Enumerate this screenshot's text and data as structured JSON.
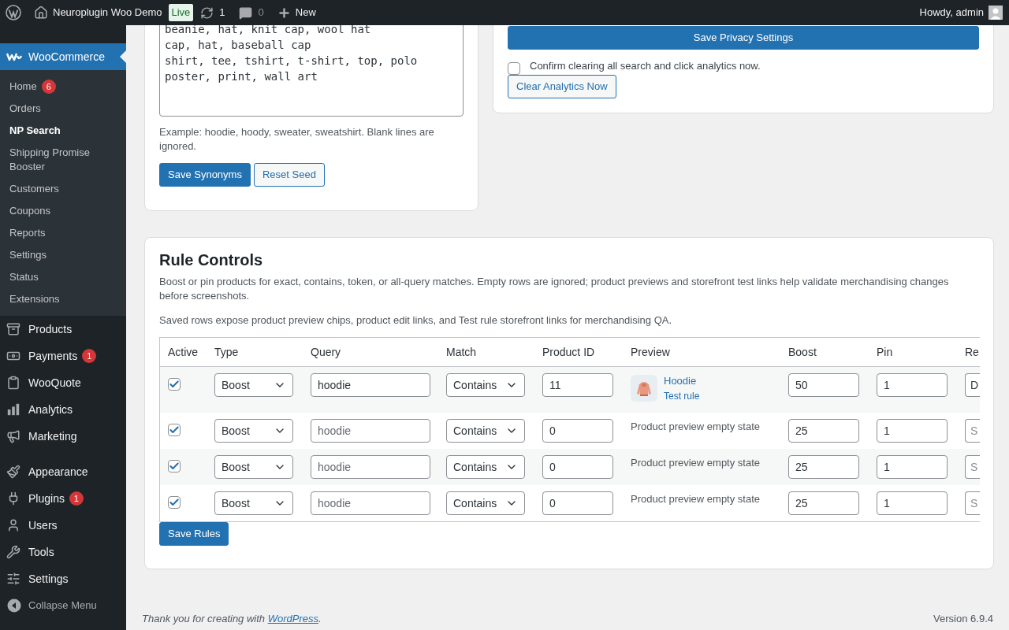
{
  "admin_bar": {
    "site": "Neuroplugin Woo Demo",
    "status": "Live",
    "updates": "1",
    "comments": "0",
    "new": "New",
    "greeting": "Howdy, admin"
  },
  "sidebar": {
    "current": {
      "label": "WooCommerce",
      "selected": true
    },
    "submenu": [
      {
        "label": "Home",
        "badge": "6",
        "selected": false
      },
      {
        "label": "Orders",
        "selected": false
      },
      {
        "label": "NP Search",
        "selected": true
      },
      {
        "label": "Shipping Promise Booster",
        "selected": false
      },
      {
        "label": "Customers",
        "selected": false
      },
      {
        "label": "Coupons",
        "selected": false
      },
      {
        "label": "Reports",
        "selected": false
      },
      {
        "label": "Settings",
        "selected": false
      },
      {
        "label": "Status",
        "selected": false
      },
      {
        "label": "Extensions",
        "selected": false
      }
    ],
    "menu_groups": [
      [
        {
          "label": "Products"
        },
        {
          "label": "Payments",
          "badge": "1"
        },
        {
          "label": "WooQuote"
        },
        {
          "label": "Analytics"
        },
        {
          "label": "Marketing"
        }
      ],
      [
        {
          "label": "Appearance"
        },
        {
          "label": "Plugins",
          "badge": "1"
        },
        {
          "label": "Users"
        },
        {
          "label": "Tools"
        },
        {
          "label": "Settings"
        }
      ]
    ],
    "collapse": "Collapse Menu"
  },
  "synonyms_card": {
    "lines": "beanie, hat, knit cap, wool hat\ncap, hat, baseball cap\nshirt, tee, tshirt, t-shirt, top, polo\nposter, print, wall art",
    "help": "Example: hoodie, hoody, sweater, sweatshirt. Blank lines are ignored.",
    "buttons": [
      {
        "label": "Save Synonyms",
        "kind": "primary"
      },
      {
        "label": "Reset Seed",
        "kind": "secondary"
      }
    ]
  },
  "privacy_card": {
    "save": "Save Privacy Settings",
    "confirm": {
      "label": "Confirm clearing all search and click analytics now.",
      "checked": false
    },
    "clear": "Clear Analytics Now"
  },
  "rules_card": {
    "title": "Rule Controls",
    "description": "Boost or pin products for exact, contains, token, or all-query matches. Empty rows are ignored; product previews and storefront test links help validate merchandising changes before screenshots.",
    "note": "Saved rows expose product preview chips, product edit links, and Test rule storefront links for merchandising QA.",
    "columns": [
      "Active",
      "Type",
      "Query",
      "Match",
      "Product ID",
      "Preview",
      "Boost",
      "Pin",
      "Re"
    ],
    "rows": [
      {
        "active": true,
        "type": "Boost",
        "query": {
          "value": "hoodie"
        },
        "match": "Contains",
        "product_id": "11",
        "preview": {
          "kind": "product",
          "name": "Hoodie",
          "link": "Test rule"
        },
        "boost": "50",
        "pin": "1",
        "column_9": {
          "value": "D"
        }
      },
      {
        "active": true,
        "type": "Boost",
        "query": {
          "placeholder": "hoodie"
        },
        "match": "Contains",
        "product_id": "0",
        "preview": {
          "kind": "empty",
          "text": "Product preview empty state"
        },
        "boost": "25",
        "pin": "1",
        "column_9": {
          "placeholder": "S"
        }
      },
      {
        "active": true,
        "type": "Boost",
        "query": {
          "placeholder": "hoodie"
        },
        "match": "Contains",
        "product_id": "0",
        "preview": {
          "kind": "empty",
          "text": "Product preview empty state"
        },
        "boost": "25",
        "pin": "1",
        "column_9": {
          "placeholder": "S"
        }
      },
      {
        "active": true,
        "type": "Boost",
        "query": {
          "placeholder": "hoodie"
        },
        "match": "Contains",
        "product_id": "0",
        "preview": {
          "kind": "empty",
          "text": "Product preview empty state"
        },
        "boost": "25",
        "pin": "1",
        "column_9": {
          "placeholder": "S"
        }
      }
    ],
    "save": "Save Rules"
  },
  "footer": {
    "thanks": "Thank you for creating with",
    "link": "WordPress",
    "end": ".",
    "version": "Version 6.9.4"
  }
}
